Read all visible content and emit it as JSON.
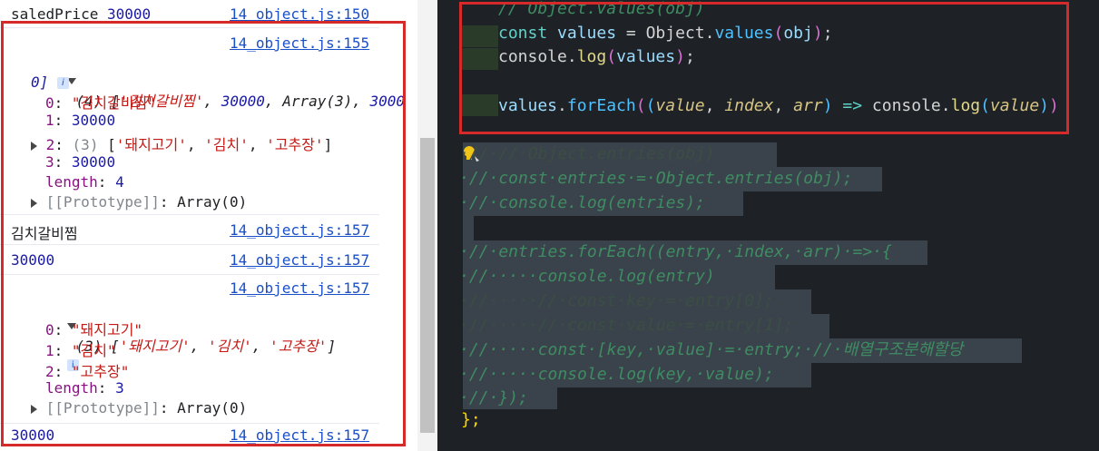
{
  "console": {
    "top_row": {
      "label": "saledPrice",
      "value": "30000",
      "source": "14_object.js:150"
    },
    "array1": {
      "source": "14_object.js:155",
      "count": "(4)",
      "summary_s1": "'김치갈비찜'",
      "summary_n": "30000",
      "summary_arr": "Array(3)",
      "summary_s2a": "3000",
      "summary_s2b": "0]",
      "items": [
        {
          "key": "0",
          "value": "\"김치갈비찜\""
        },
        {
          "key": "1",
          "value": "30000"
        },
        {
          "key": "2",
          "count": "(3)",
          "value1": "'돼지고기'",
          "value2": "'김치'",
          "value3": "'고추장'"
        },
        {
          "key": "3",
          "value": "30000"
        }
      ],
      "length_label": "length",
      "length_value": "4",
      "proto_label": "[[Prototype]]",
      "proto_value": "Array(0)"
    },
    "log_name": {
      "text": "김치갈비찜",
      "source": "14_object.js:157"
    },
    "log_price": {
      "text": "30000",
      "source": "14_object.js:157"
    },
    "array2": {
      "source": "14_object.js:157",
      "count": "(3)",
      "summary1": "'돼지고기'",
      "summary2": "'김치'",
      "summary3": "'고추장'",
      "items": [
        {
          "key": "0",
          "value": "\"돼지고기\""
        },
        {
          "key": "1",
          "value": "\"김치\""
        },
        {
          "key": "2",
          "value": "\"고추장\""
        }
      ],
      "length_label": "length",
      "length_value": "3",
      "proto_label": "[[Prototype]]",
      "proto_value": "Array(0)"
    },
    "bottom_row": {
      "text": "30000",
      "source": "14_object.js:157"
    },
    "info_glyph": "i"
  },
  "editor": {
    "line1": "// Object.values(obj)",
    "line2": {
      "kw": "const",
      "var": "values",
      "eq": " = ",
      "obj": "Object",
      "dot": ".",
      "fn": "values",
      "arg": "obj",
      "end": ");"
    },
    "line3": {
      "obj": "console",
      "dot": ".",
      "fn": "log",
      "arg": "values",
      "end": ");"
    },
    "line5": {
      "obj": "values",
      "fn": "forEach",
      "p1": "value",
      "p2": "index",
      "p3": "arr",
      "arrow": "=>",
      "obj2": "console",
      "fn2": "log",
      "p4": "value"
    },
    "comments": [
      "·//·//·Object.entries(obj)",
      "·//·const·entries·=·Object.entries(obj);",
      "·//·console.log(entries);",
      "",
      "·//·entries.forEach((entry,·index,·arr)·=>·{",
      "·//·····console.log(entry)",
      "·//·····//·const·key·=·entry[0];",
      "·//·····//·const·value·=·entry[1];",
      "·//·····const·[key,·value]·=·entry;·//·배열구조분해할당",
      "·//·····console.log(key,·value);",
      "·//·});"
    ],
    "closing": "};",
    "lightbulb": "lightbulb-icon"
  },
  "colors": {
    "highlight_frame": "#d62a2a",
    "editor_bg": "#1e2226",
    "console_link": "#1a4fc7"
  }
}
